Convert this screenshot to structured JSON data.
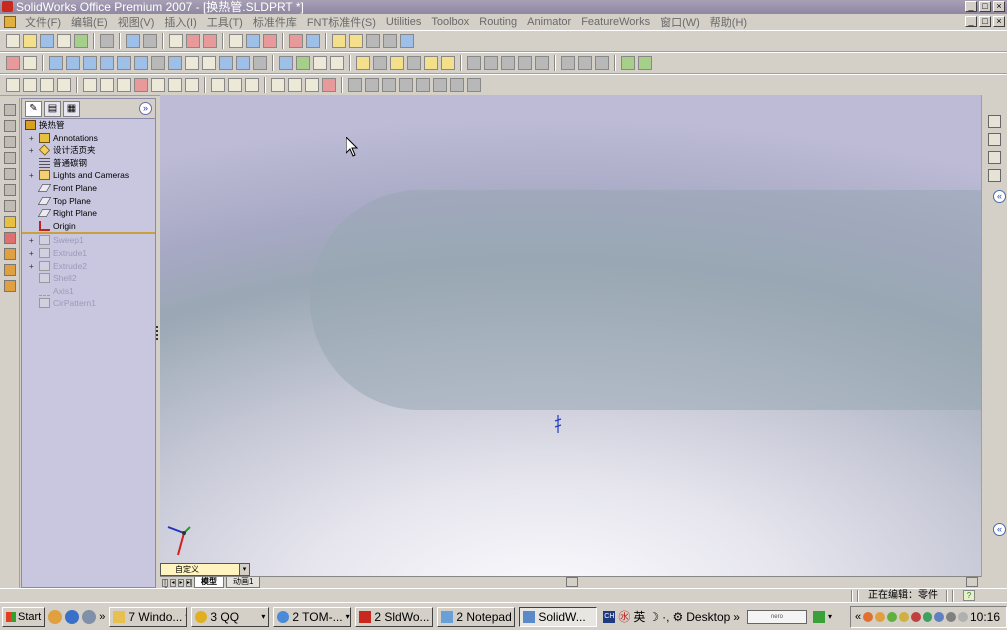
{
  "title": "SolidWorks Office Premium 2007 - [换热管.SLDPRT *]",
  "menu": [
    "文件(F)",
    "编辑(E)",
    "视图(V)",
    "插入(I)",
    "工具(T)",
    "标准件库",
    "FNT标准件(S)",
    "Utilities",
    "Toolbox",
    "Routing",
    "Animator",
    "FeatureWorks",
    "窗口(W)",
    "帮助(H)"
  ],
  "window_controls": [
    "_",
    "□",
    "×"
  ],
  "feature_manager": {
    "items": [
      {
        "label": "换热管",
        "icon": "part-icon",
        "expand": "",
        "dim": false
      },
      {
        "label": "Annotations",
        "icon": "annotations-icon",
        "expand": "+",
        "dim": false
      },
      {
        "label": "设计活页夹",
        "icon": "design-binder-icon",
        "expand": "+",
        "dim": false
      },
      {
        "label": "普通碳钢",
        "icon": "material-icon",
        "expand": "",
        "dim": false
      },
      {
        "label": "Lights and Cameras",
        "icon": "lights-icon",
        "expand": "+",
        "dim": false
      },
      {
        "label": "Front Plane",
        "icon": "plane-icon",
        "expand": "",
        "dim": false
      },
      {
        "label": "Top Plane",
        "icon": "plane-icon",
        "expand": "",
        "dim": false
      },
      {
        "label": "Right Plane",
        "icon": "plane-icon",
        "expand": "",
        "dim": false
      },
      {
        "label": "Origin",
        "icon": "origin-icon",
        "expand": "",
        "dim": false
      },
      {
        "label": "Sweep1",
        "icon": "sweep-icon",
        "expand": "+",
        "dim": true
      },
      {
        "label": "Extrude1",
        "icon": "extrude-icon",
        "expand": "+",
        "dim": true
      },
      {
        "label": "Extrude2",
        "icon": "extrude-icon",
        "expand": "+",
        "dim": true
      },
      {
        "label": "Shell2",
        "icon": "shell-icon",
        "expand": "",
        "dim": true
      },
      {
        "label": "Axis1",
        "icon": "axis-icon",
        "expand": "",
        "dim": true
      },
      {
        "label": "CirPattern1",
        "icon": "pattern-icon",
        "expand": "",
        "dim": true
      }
    ]
  },
  "view_combo": "自定义",
  "doc_tabs": [
    "模型",
    "动画1"
  ],
  "status": {
    "text": "正在编辑：零件",
    "help": "?"
  },
  "taskbar": {
    "start": "Start",
    "tasks": [
      {
        "label": "7 Windo...",
        "arrow": "▾"
      },
      {
        "label": "3 QQ",
        "arrow": "▾"
      },
      {
        "label": "2 TOM-...",
        "arrow": "▾"
      },
      {
        "label": "2 SldWo...",
        "arrow": "▾"
      },
      {
        "label": "2 Notepad",
        "arrow": "▾"
      },
      {
        "label": "SolidW...",
        "arrow": ""
      }
    ],
    "ime_lang": "英",
    "desktop": "Desktop",
    "clock": "10:16"
  }
}
